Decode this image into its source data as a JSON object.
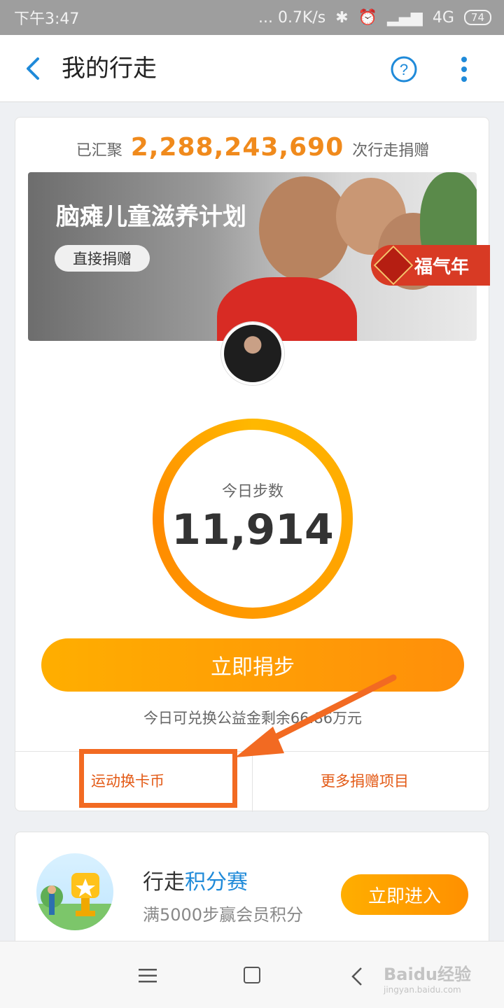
{
  "status_bar": {
    "time": "下午3:47",
    "network": "... 0.7K/s",
    "signal": "4G",
    "battery": "74"
  },
  "header": {
    "title": "我的行走",
    "back_icon": "chevron-left-icon",
    "help_icon": "question-circle-icon",
    "more_icon": "more-vertical-icon"
  },
  "summary": {
    "prefix": "已汇聚",
    "total": "2,288,243,690",
    "suffix": "次行走捐赠"
  },
  "banner": {
    "title": "脑瘫儿童滋养计划",
    "button": "直接捐赠"
  },
  "badge": {
    "label": "福气年"
  },
  "steps": {
    "label": "今日步数",
    "value": "11,914",
    "ring_progress": 1.0
  },
  "donate": {
    "button": "立即捐步",
    "remaining_text": "今日可兑换公益金剩余66.86万元"
  },
  "links": {
    "left": "运动换卡币",
    "right": "更多捐赠项目"
  },
  "promo": {
    "title_prefix": "行走",
    "title_highlight": "积分赛",
    "subtitle": "满5000步赢会员积分",
    "button": "立即进入"
  },
  "watermark": {
    "main": "Baidu经验",
    "sub": "jingyan.baidu.com"
  },
  "colors": {
    "accent_orange": "#ff9500",
    "link_orange": "#e35a16",
    "total_orange": "#f08a1c",
    "highlight_border": "#f26a22",
    "blue": "#1f8ad9"
  }
}
